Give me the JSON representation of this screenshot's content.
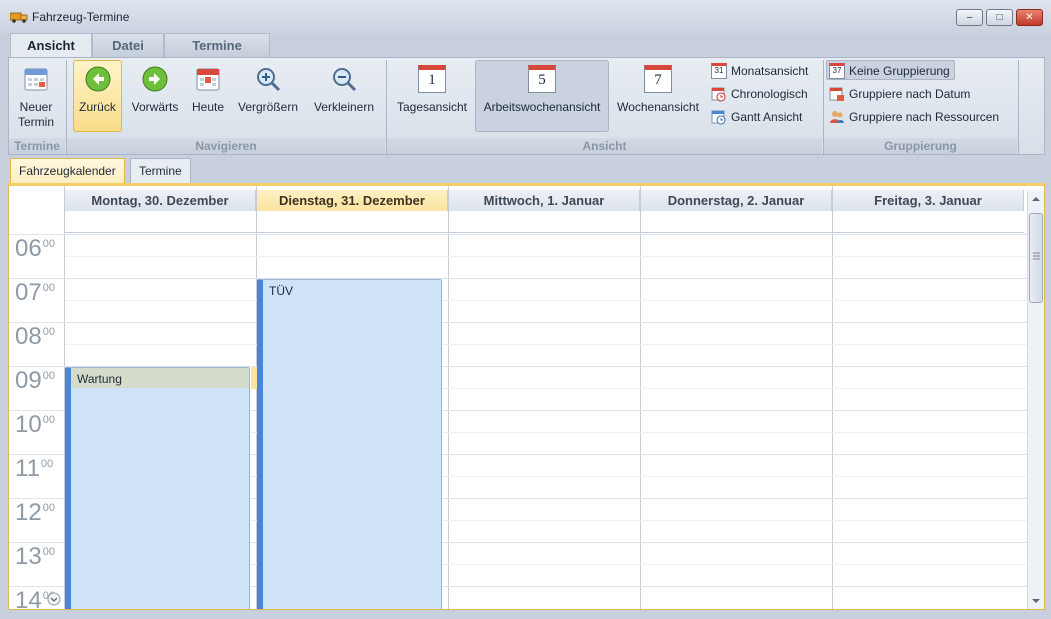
{
  "window": {
    "title": "Fahrzeug-Termine",
    "minimize": "–",
    "maximize": "□",
    "close": "✕"
  },
  "ribbon_tabs": [
    "Ansicht",
    "Datei",
    "Termine"
  ],
  "groups": {
    "termine": {
      "label": "Termine",
      "new_appointment": "Neuer Termin"
    },
    "navigieren": {
      "label": "Navigieren",
      "back": "Zurück",
      "forward": "Vorwärts",
      "today": "Heute",
      "zoom_in": "Vergrößern",
      "zoom_out": "Verkleinern"
    },
    "ansicht": {
      "label": "Ansicht",
      "day_view": "Tagesansicht",
      "workweek_view": "Arbeitswochenansicht",
      "week_view": "Wochenansicht",
      "day_icon_num": "1",
      "workweek_icon_num": "5",
      "week_icon_num": "7",
      "month_view": "Monatsansicht",
      "chronological": "Chronologisch",
      "gantt": "Gantt Ansicht",
      "month_icon_num": "31"
    },
    "gruppierung": {
      "label": "Gruppierung",
      "none": "Keine Gruppierung",
      "by_date": "Gruppiere nach Datum",
      "by_resource": "Gruppiere nach Ressourcen",
      "icon_num": "37"
    }
  },
  "doc_tabs": [
    "Fahrzeugkalender",
    "Termine"
  ],
  "calendar": {
    "days": [
      "Montag, 30. Dezember",
      "Dienstag, 31. Dezember",
      "Mittwoch, 1. Januar",
      "Donnerstag, 2. Januar",
      "Freitag, 3. Januar"
    ],
    "today_index": 1,
    "hours": [
      "06",
      "07",
      "08",
      "09",
      "10",
      "11",
      "12",
      "13",
      "14"
    ],
    "minutes": "00",
    "appointments": [
      {
        "subject": "Wartung",
        "day": "Montag, 30. Dezember",
        "start": "09:00"
      },
      {
        "subject": "TÜV",
        "day": "Dienstag, 31. Dezember",
        "start": "07:00"
      }
    ]
  },
  "colors": {
    "accent": "#4a86d4",
    "appointment": "#cfe3f8",
    "today_header": "#fbe3a0"
  }
}
